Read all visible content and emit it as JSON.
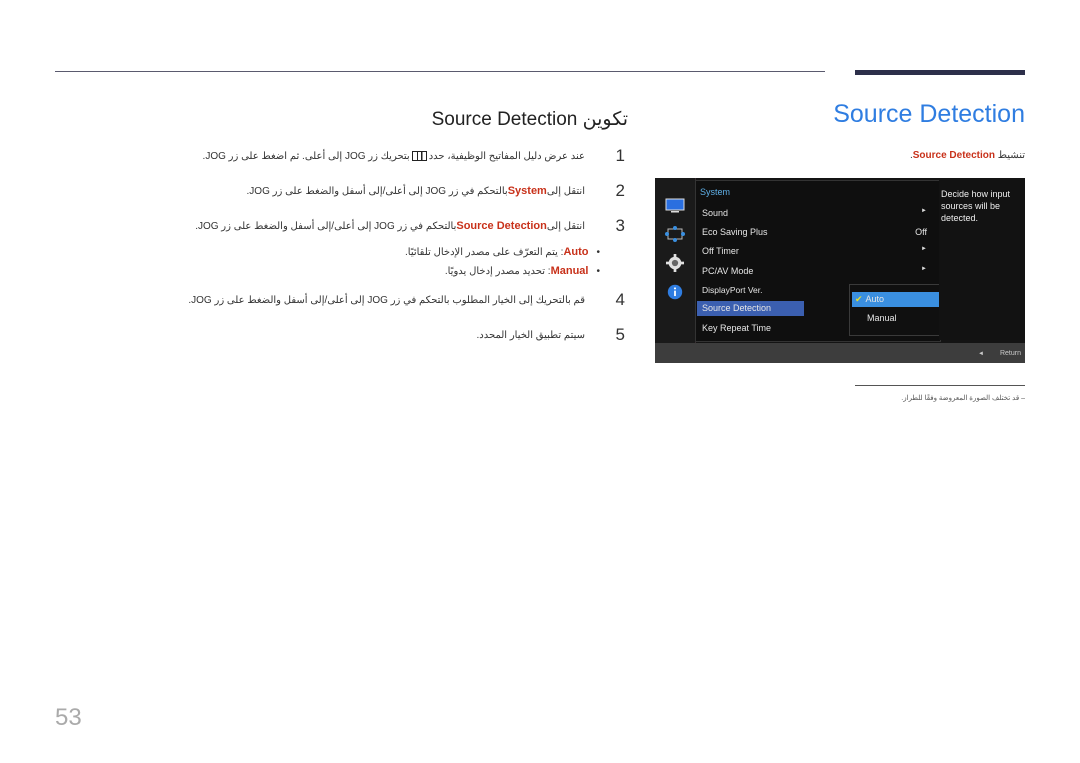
{
  "section_title": "Source Detection",
  "sub_note": {
    "prefix": "تنشيط ",
    "highlight": "Source Detection",
    "suffix": "."
  },
  "heading": "تكوين Source Detection",
  "steps": [
    {
      "num": "1",
      "before": "عند عرض دليل المفاتيح الوظيفية، حدد ",
      "icon": "grid-menu-icon",
      "after": " بتحريك زر JOG إلى أعلى. ثم اضغط على زر JOG."
    },
    {
      "num": "2",
      "before": "انتقل إلى ",
      "highlight": "System",
      "after": " بالتحكم في زر JOG إلى أعلى/إلى أسفل والضغط على زر JOG."
    },
    {
      "num": "3",
      "before": "انتقل إلى ",
      "highlight": "Source Detection",
      "after": " بالتحكم في زر JOG إلى أعلى/إلى أسفل والضغط على زر JOG."
    },
    {
      "num": "4",
      "text": "قم بالتحريك إلى الخيار المطلوب بالتحكم في زر JOG إلى أعلى/إلى أسفل والضغط على زر JOG."
    },
    {
      "num": "5",
      "text": "سيتم تطبيق الخيار المحدد."
    }
  ],
  "bullets": [
    {
      "highlight": "Auto",
      "text": ": يتم التعرّف على مصدر الإدخال تلقائيًا."
    },
    {
      "highlight": "Manual",
      "text": ": تحديد مصدر إدخال يدويًا."
    }
  ],
  "osd": {
    "category": "System",
    "items": [
      {
        "label": "Sound",
        "value": "►"
      },
      {
        "label": "Eco Saving Plus",
        "value": "Off"
      },
      {
        "label": "Off Timer",
        "value": "►"
      },
      {
        "label": "PC/AV Mode",
        "value": "►"
      },
      {
        "label": "DisplayPort Ver.",
        "value": ""
      },
      {
        "label": "Source Detection",
        "value": ""
      },
      {
        "label": "Key Repeat Time",
        "value": ""
      }
    ],
    "selected_item": "Source Detection",
    "options": [
      {
        "label": "Auto",
        "checked": true
      },
      {
        "label": "Manual",
        "checked": false
      }
    ],
    "description": "Decide how input sources will be detected.",
    "return_label": "Return",
    "side_icons": [
      "monitor-icon",
      "resize-icon",
      "gear-icon",
      "info-icon"
    ],
    "colors": {
      "accent": "#3a8fe0",
      "selection": "#3b5fb0",
      "check": "#e8e02c",
      "category": "#5fb0e8"
    }
  },
  "footnote": "– قد تختلف الصورة المعروضة وفقًا للطراز.",
  "page_number": "53",
  "colors": {
    "title_blue": "#2f7de1",
    "highlight_red": "#c8311a"
  }
}
